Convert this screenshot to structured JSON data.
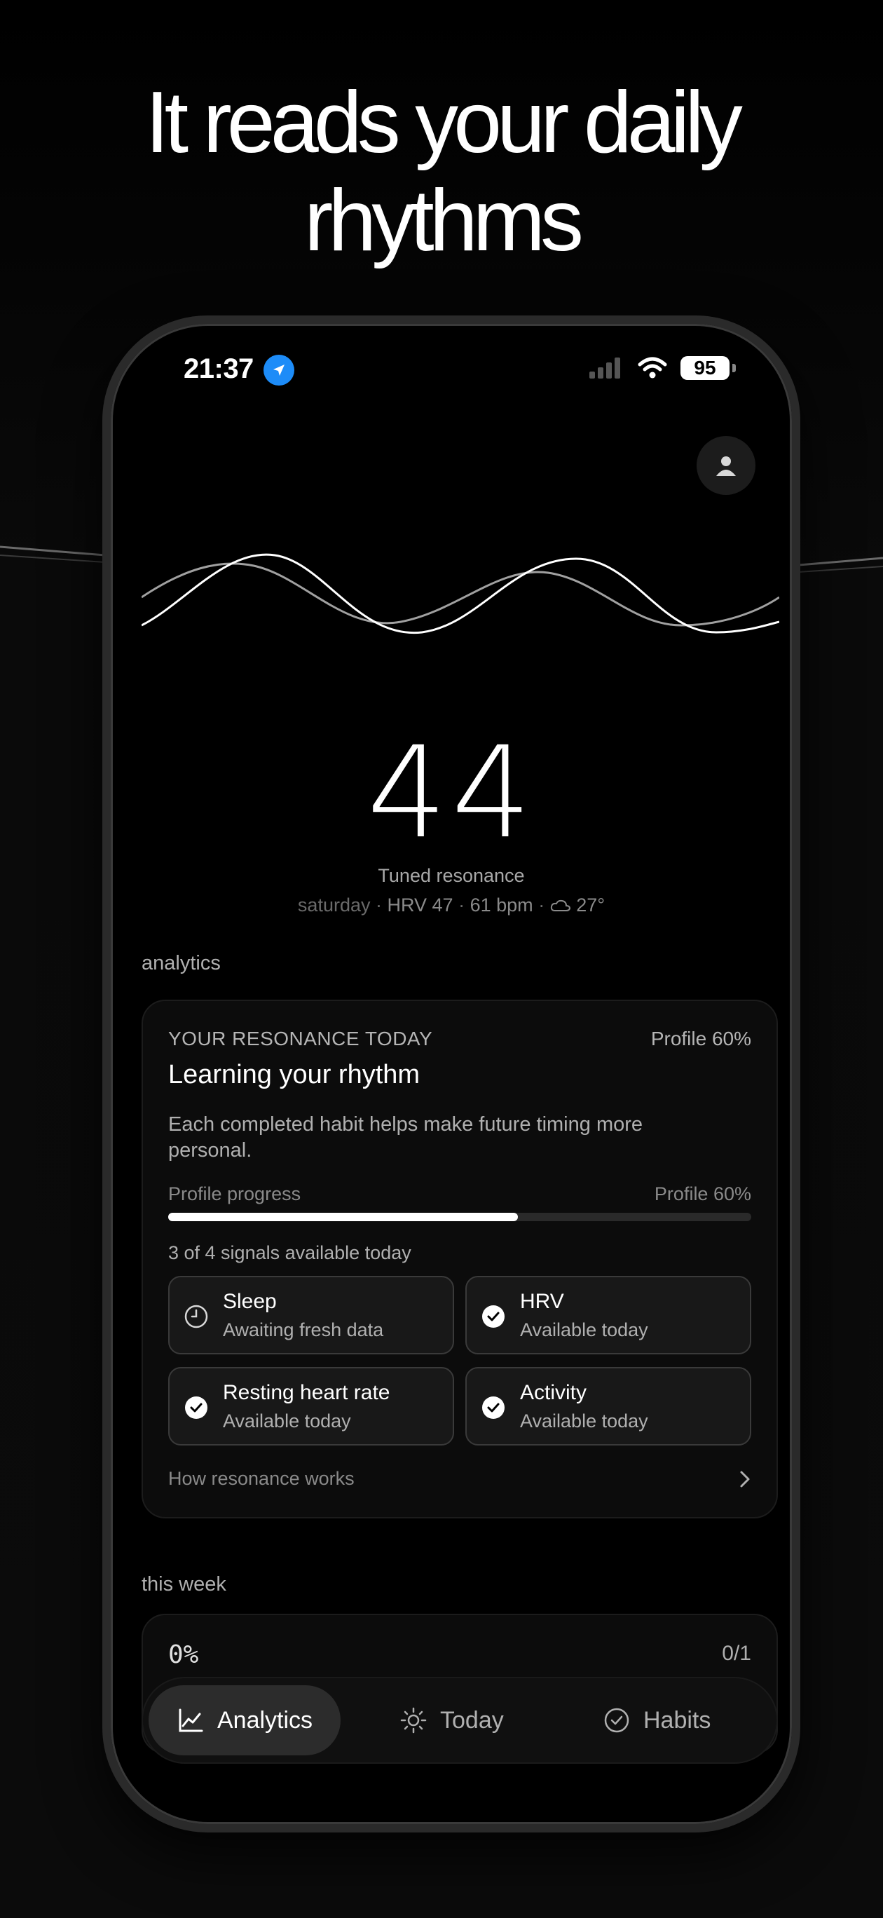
{
  "headline": {
    "line1": "It reads your daily",
    "line2": "rhythms"
  },
  "status_bar": {
    "time": "21:37",
    "battery": "95"
  },
  "hero": {
    "score": "44",
    "label": "Tuned resonance",
    "day": "saturday",
    "hrv": "HRV 47",
    "bpm": "61 bpm",
    "temp": "27°",
    "separator": "·"
  },
  "analytics": {
    "section_title": "analytics",
    "kicker": "YOUR RESONANCE TODAY",
    "profile_badge": "Profile 60%",
    "title": "Learning your rhythm",
    "description": "Each completed habit helps make future timing more personal.",
    "progress_label": "Profile progress",
    "progress_value_label": "Profile 60%",
    "progress": 0.6,
    "signals_summary": "3 of 4 signals available today",
    "signals": [
      {
        "name": "Sleep",
        "status": "Awaiting fresh data",
        "icon": "clock-icon"
      },
      {
        "name": "HRV",
        "status": "Available today",
        "icon": "check-circle-icon"
      },
      {
        "name": "Resting heart rate",
        "status": "Available today",
        "icon": "check-circle-icon"
      },
      {
        "name": "Activity",
        "status": "Available today",
        "icon": "check-circle-icon"
      }
    ],
    "link": "How resonance works"
  },
  "week": {
    "section_title": "this week",
    "percent": "0%",
    "count": "0/1"
  },
  "tabs": [
    {
      "label": "Analytics",
      "icon": "chart-line-icon",
      "active": true
    },
    {
      "label": "Today",
      "icon": "sun-icon",
      "active": false
    },
    {
      "label": "Habits",
      "icon": "check-circle-icon",
      "active": false
    }
  ],
  "colors": {
    "background": "#000000",
    "accent_location": "#1d8cf8",
    "text": "#ffffff",
    "muted": "#8a8a8a"
  }
}
